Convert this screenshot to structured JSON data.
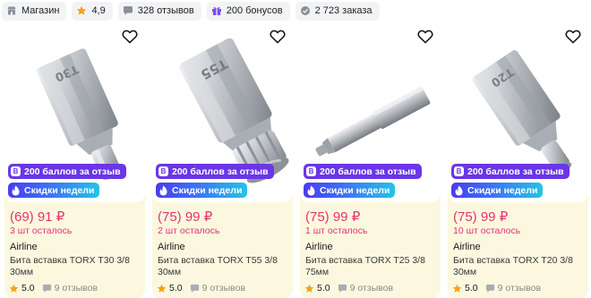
{
  "store_bar": {
    "shop_label": "Магазин",
    "rating": "4,9",
    "reviews": "328 отзывов",
    "bonuses": "200 бонусов",
    "orders": "2 723 заказа"
  },
  "colors": {
    "price": "#e3346e",
    "card_bg": "#fbf8df",
    "reviews_badge": "#6a36e8",
    "star": "#f4a21a"
  },
  "products": [
    {
      "price": "(69) 91 ₽",
      "stock": "3 шт осталось",
      "brand": "Airline",
      "title": "Бита вставка TORX T30 3/8 30мм",
      "badge_reviews": "200 баллов за отзыв",
      "badge_deals": "Скидки недели",
      "rating": "5.0",
      "reviews": "9 отзывов",
      "engraving": "T30"
    },
    {
      "price": "(75) 99 ₽",
      "stock": "2 шт осталось",
      "brand": "Airline",
      "title": "Бита вставка TORX T55 3/8 30мм",
      "badge_reviews": "200 баллов за отзыв",
      "badge_deals": "Скидки недели",
      "rating": "5.0",
      "reviews": "9 отзывов",
      "engraving": "T55"
    },
    {
      "price": "(75) 99 ₽",
      "stock": "1 шт осталось",
      "brand": "Airline",
      "title": "Бита вставка TORX T25 3/8 75мм",
      "badge_reviews": "200 баллов за отзыв",
      "badge_deals": "Скидки недели",
      "rating": "5.0",
      "reviews": "9 отзывов",
      "engraving": ""
    },
    {
      "price": "(75) 99 ₽",
      "stock": "10 шт осталось",
      "brand": "Airline",
      "title": "Бита вставка TORX T20 3/8 30мм",
      "badge_reviews": "200 баллов за отзыв",
      "badge_deals": "Скидки недели",
      "rating": "5.0",
      "reviews": "9 отзывов",
      "engraving": "T20"
    }
  ]
}
